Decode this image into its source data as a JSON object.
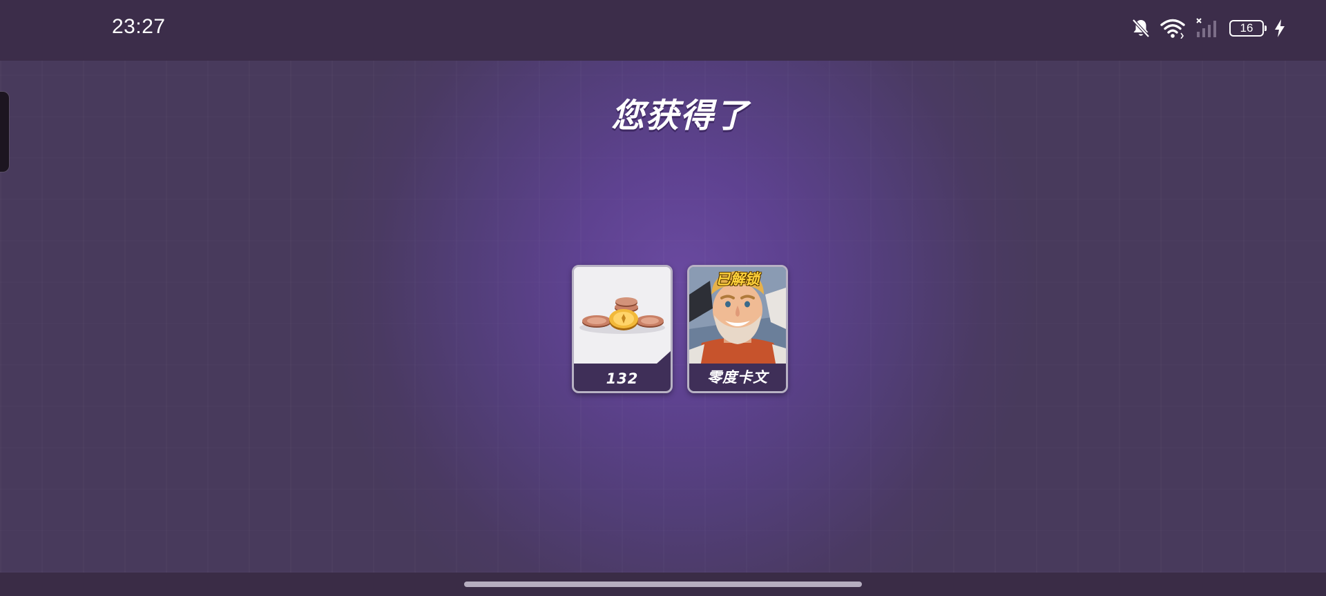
{
  "status_bar": {
    "time": "23:27",
    "battery_level": "16",
    "icons": [
      "bell-muted-icon",
      "wifi-icon",
      "cellular-no-signal-icon",
      "battery-icon",
      "charging-bolt-icon"
    ]
  },
  "reward_screen": {
    "title": "您获得了",
    "rewards": [
      {
        "type": "coins",
        "icon": "coins-icon",
        "label": "132"
      },
      {
        "type": "hero",
        "icon": "hero-portrait",
        "badge": "已解锁",
        "label": "零度卡文"
      }
    ]
  },
  "colors": {
    "background": "#4a3a5c",
    "glow": "#6a4aa0",
    "card_footer": "#3f2f58",
    "badge_text": "#ffd23a",
    "text": "#ffffff"
  }
}
